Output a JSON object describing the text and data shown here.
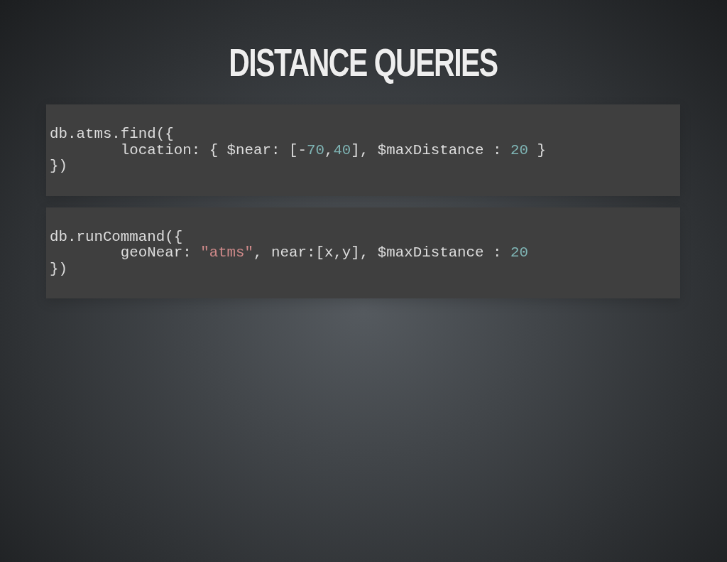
{
  "slide": {
    "title": "DISTANCE QUERIES",
    "code_blocks": [
      {
        "lines": [
          [
            {
              "kind": "plain",
              "text": "db.atms.find({"
            }
          ],
          [
            {
              "kind": "plain",
              "text": "\tlocation: { $near: [-"
            },
            {
              "kind": "number",
              "text": "70"
            },
            {
              "kind": "plain",
              "text": ","
            },
            {
              "kind": "number",
              "text": "40"
            },
            {
              "kind": "plain",
              "text": "], $maxDistance : "
            },
            {
              "kind": "number",
              "text": "20"
            },
            {
              "kind": "plain",
              "text": " }"
            }
          ],
          [
            {
              "kind": "plain",
              "text": "})"
            }
          ]
        ]
      },
      {
        "lines": [
          [
            {
              "kind": "plain",
              "text": "db.runCommand({"
            }
          ],
          [
            {
              "kind": "plain",
              "text": "\tgeoNear: "
            },
            {
              "kind": "string",
              "text": "\"atms\""
            },
            {
              "kind": "plain",
              "text": ", near:[x,y], $maxDistance : "
            },
            {
              "kind": "number",
              "text": "20"
            }
          ],
          [
            {
              "kind": "plain",
              "text": "})"
            }
          ]
        ]
      }
    ]
  }
}
